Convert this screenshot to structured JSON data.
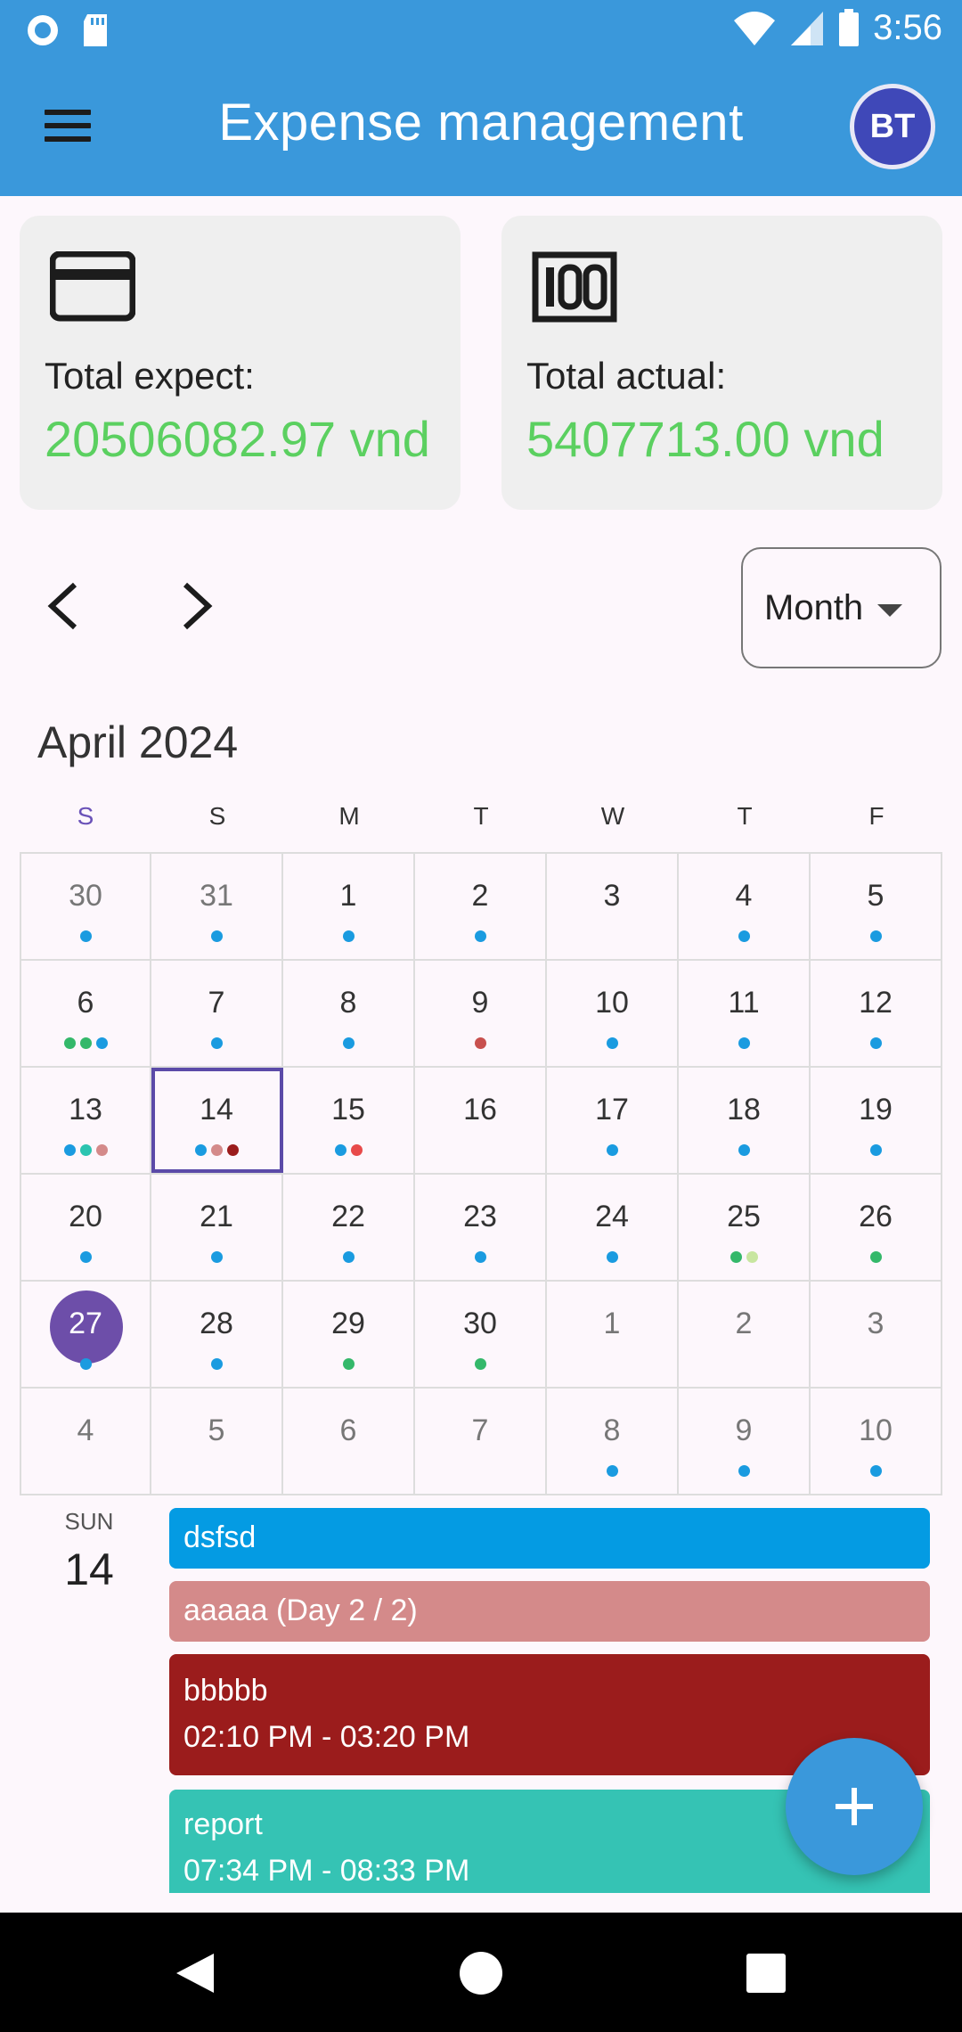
{
  "status_bar": {
    "time": "3:56"
  },
  "app_bar": {
    "title": "Expense management",
    "avatar_initials": "BT"
  },
  "summary": {
    "expect_label": "Total expect:",
    "expect_value": "20506082.97 vnd",
    "actual_label": "Total actual:",
    "actual_value": "5407713.00 vnd",
    "value_color": "#5bd060"
  },
  "view_selector": {
    "selected": "Month"
  },
  "calendar": {
    "month_label": "April 2024",
    "weekdays": [
      "S",
      "S",
      "M",
      "T",
      "W",
      "T",
      "F"
    ],
    "selected_day": "14",
    "today": "27",
    "rows": [
      [
        {
          "d": "30",
          "other": true,
          "dots": [
            "#1a9be0"
          ]
        },
        {
          "d": "31",
          "other": true,
          "dots": [
            "#1a9be0"
          ]
        },
        {
          "d": "1",
          "dots": [
            "#1a9be0"
          ]
        },
        {
          "d": "2",
          "dots": [
            "#1a9be0"
          ]
        },
        {
          "d": "3",
          "dots": []
        },
        {
          "d": "4",
          "dots": [
            "#1a9be0"
          ]
        },
        {
          "d": "5",
          "dots": [
            "#1a9be0"
          ]
        }
      ],
      [
        {
          "d": "6",
          "dots": [
            "#34b86a",
            "#34b86a",
            "#1a9be0"
          ]
        },
        {
          "d": "7",
          "dots": [
            "#1a9be0"
          ]
        },
        {
          "d": "8",
          "dots": [
            "#1a9be0"
          ]
        },
        {
          "d": "9",
          "dots": [
            "#c8504e"
          ]
        },
        {
          "d": "10",
          "dots": [
            "#1a9be0"
          ]
        },
        {
          "d": "11",
          "dots": [
            "#1a9be0"
          ]
        },
        {
          "d": "12",
          "dots": [
            "#1a9be0"
          ]
        }
      ],
      [
        {
          "d": "13",
          "dots": [
            "#1a9be0",
            "#2bc4b0",
            "#d48a8a"
          ]
        },
        {
          "d": "14",
          "selected": true,
          "dots": [
            "#1a9be0",
            "#d48a8a",
            "#9b1c1c"
          ]
        },
        {
          "d": "15",
          "dots": [
            "#1a9be0",
            "#e84a4a"
          ]
        },
        {
          "d": "16",
          "dots": []
        },
        {
          "d": "17",
          "dots": [
            "#1a9be0"
          ]
        },
        {
          "d": "18",
          "dots": [
            "#1a9be0"
          ]
        },
        {
          "d": "19",
          "dots": [
            "#1a9be0"
          ]
        }
      ],
      [
        {
          "d": "20",
          "dots": [
            "#1a9be0"
          ]
        },
        {
          "d": "21",
          "dots": [
            "#1a9be0"
          ]
        },
        {
          "d": "22",
          "dots": [
            "#1a9be0"
          ]
        },
        {
          "d": "23",
          "dots": [
            "#1a9be0"
          ]
        },
        {
          "d": "24",
          "dots": [
            "#1a9be0"
          ]
        },
        {
          "d": "25",
          "dots": [
            "#34b86a",
            "#c8e6a0"
          ]
        },
        {
          "d": "26",
          "dots": [
            "#34b86a"
          ]
        }
      ],
      [
        {
          "d": "27",
          "today": true,
          "dots": [
            "#1a9be0"
          ]
        },
        {
          "d": "28",
          "dots": [
            "#1a9be0"
          ]
        },
        {
          "d": "29",
          "dots": [
            "#34b86a"
          ]
        },
        {
          "d": "30",
          "dots": [
            "#34b86a"
          ]
        },
        {
          "d": "1",
          "other": true,
          "dots": []
        },
        {
          "d": "2",
          "other": true,
          "dots": []
        },
        {
          "d": "3",
          "other": true,
          "dots": []
        }
      ],
      [
        {
          "d": "4",
          "other": true,
          "dots": []
        },
        {
          "d": "5",
          "other": true,
          "dots": []
        },
        {
          "d": "6",
          "other": true,
          "dots": []
        },
        {
          "d": "7",
          "other": true,
          "dots": []
        },
        {
          "d": "8",
          "other": true,
          "dots": [
            "#1a9be0"
          ]
        },
        {
          "d": "9",
          "other": true,
          "dots": [
            "#1a9be0"
          ]
        },
        {
          "d": "10",
          "other": true,
          "dots": [
            "#1a9be0"
          ]
        }
      ]
    ]
  },
  "agenda": {
    "day_name": "SUN",
    "day_number": "14",
    "events": [
      {
        "title": "dsfsd",
        "time": "",
        "color": "#049be3"
      },
      {
        "title": "aaaaa (Day 2 / 2)",
        "time": "",
        "color": "#d48a8a"
      },
      {
        "title": "bbbbb",
        "time": "02:10 PM - 03:20 PM",
        "color": "#9b1c1c"
      },
      {
        "title": "report",
        "time": "07:34 PM - 08:33 PM",
        "color": "#35c3b4"
      }
    ]
  },
  "icons": {
    "menu": "menu-icon",
    "card": "credit-card-icon",
    "hundred": "hundred-icon",
    "prev": "chevron-left-icon",
    "next": "chevron-right-icon",
    "add": "plus-icon"
  },
  "colors": {
    "primary": "#3a98db",
    "today": "#6d4ea9",
    "selected_border": "#5b4aa8"
  }
}
